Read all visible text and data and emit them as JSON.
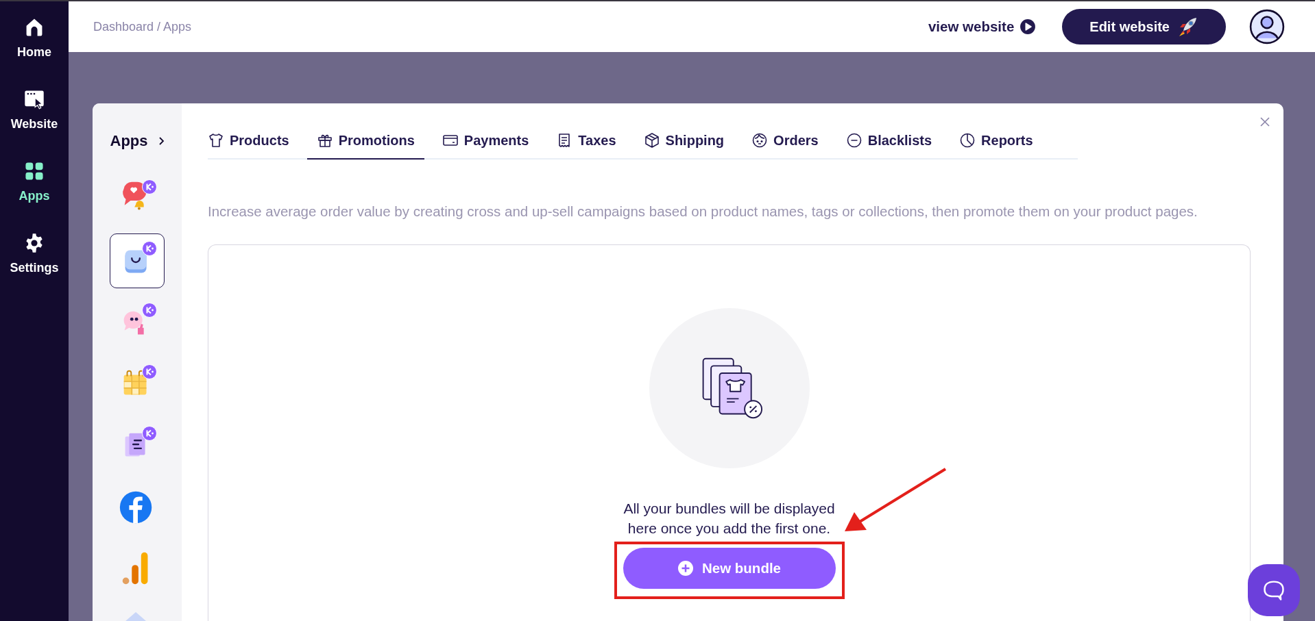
{
  "nav": [
    {
      "kind": "home",
      "label": "Home",
      "selected": false
    },
    {
      "kind": "website",
      "label": "Website",
      "selected": false
    },
    {
      "kind": "apps",
      "label": "Apps",
      "selected": true
    },
    {
      "kind": "settings",
      "label": "Settings",
      "selected": false
    }
  ],
  "breadcrumb": "Dashboard / Apps",
  "header": {
    "view_link": "view website",
    "edit_button": "Edit website"
  },
  "apps_panel": {
    "title": "Apps"
  },
  "apps": [
    {
      "kind": "heart-chat",
      "badge": true,
      "selected": false
    },
    {
      "kind": "bag",
      "badge": true,
      "selected": true
    },
    {
      "kind": "quote-chat",
      "badge": true,
      "selected": false
    },
    {
      "kind": "calendar",
      "badge": true,
      "selected": false
    },
    {
      "kind": "document",
      "badge": true,
      "selected": false
    },
    {
      "kind": "facebook",
      "badge": false,
      "selected": false
    },
    {
      "kind": "analytics",
      "badge": false,
      "selected": false
    },
    {
      "kind": "diamond",
      "badge": false,
      "selected": false
    }
  ],
  "tabs": [
    {
      "kind": "shirt",
      "label": "Products",
      "selected": false
    },
    {
      "kind": "gift",
      "label": "Promotions",
      "selected": true
    },
    {
      "kind": "card",
      "label": "Payments",
      "selected": false
    },
    {
      "kind": "receipt",
      "label": "Taxes",
      "selected": false
    },
    {
      "kind": "box",
      "label": "Shipping",
      "selected": false
    },
    {
      "kind": "face",
      "label": "Orders",
      "selected": false
    },
    {
      "kind": "minus",
      "label": "Blacklists",
      "selected": false
    },
    {
      "kind": "pie",
      "label": "Reports",
      "selected": false
    }
  ],
  "description": "Increase average order value by creating cross and up-sell campaigns based on product names, tags or collections, then promote them on your product pages.",
  "empty_state": {
    "message": "All your bundles will be displayed\nhere once you add the first one.",
    "button": "New bundle"
  },
  "annotation": {
    "highlight_frame": true,
    "arrow": true
  }
}
